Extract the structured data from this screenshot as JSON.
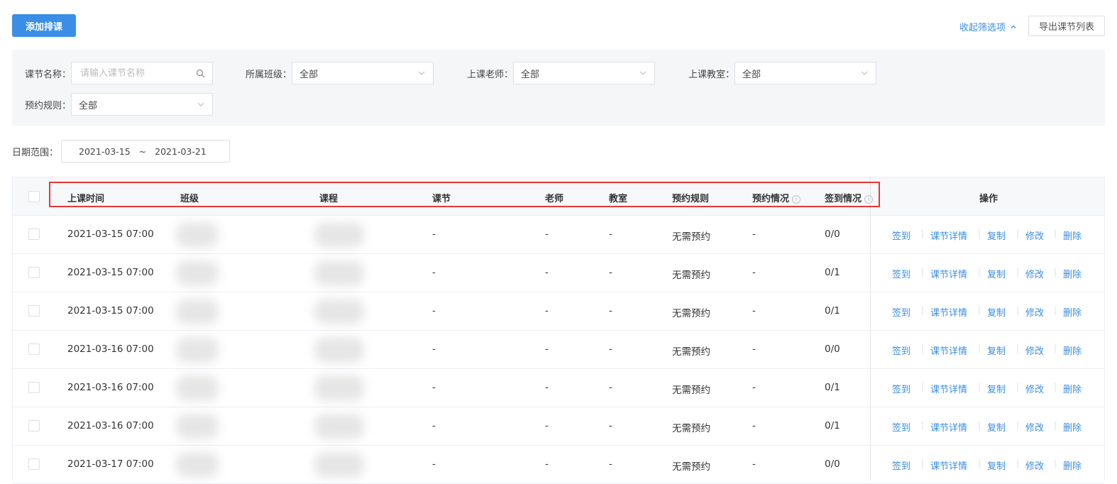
{
  "toolbar": {
    "add_label": "添加排课",
    "collapse_label": "收起筛选项",
    "export_label": "导出课节列表"
  },
  "filters": {
    "lesson_name": {
      "label": "课节名称：",
      "placeholder": "请输入课节名称"
    },
    "class": {
      "label": "所属班级：",
      "value": "全部"
    },
    "teacher": {
      "label": "上课老师：",
      "value": "全部"
    },
    "classroom": {
      "label": "上课教室：",
      "value": "全部"
    },
    "booking_rule": {
      "label": "预约规则：",
      "value": "全部"
    }
  },
  "date_range": {
    "label": "日期范围：",
    "start": "2021-03-15",
    "separator": "~",
    "end": "2021-03-21"
  },
  "table": {
    "headers": {
      "time": "上课时间",
      "class": "班级",
      "course": "课程",
      "lesson": "课节",
      "teacher": "老师",
      "classroom": "教室",
      "booking_rule": "预约规则",
      "booking_status": "预约情况",
      "signin_status": "签到情况",
      "ops": "操作"
    },
    "rows": [
      {
        "time": "2021-03-15 07:00",
        "lesson": "-",
        "teacher": "-",
        "classroom": "-",
        "booking_rule": "无需预约",
        "booking_status": "-",
        "signin": "0/0"
      },
      {
        "time": "2021-03-15 07:00",
        "lesson": "-",
        "teacher": "-",
        "classroom": "-",
        "booking_rule": "无需预约",
        "booking_status": "-",
        "signin": "0/1"
      },
      {
        "time": "2021-03-15 07:00",
        "lesson": "-",
        "teacher": "-",
        "classroom": "-",
        "booking_rule": "无需预约",
        "booking_status": "-",
        "signin": "0/1"
      },
      {
        "time": "2021-03-16 07:00",
        "lesson": "-",
        "teacher": "-",
        "classroom": "-",
        "booking_rule": "无需预约",
        "booking_status": "-",
        "signin": "0/0"
      },
      {
        "time": "2021-03-16 07:00",
        "lesson": "-",
        "teacher": "-",
        "classroom": "-",
        "booking_rule": "无需预约",
        "booking_status": "-",
        "signin": "0/1"
      },
      {
        "time": "2021-03-16 07:00",
        "lesson": "-",
        "teacher": "-",
        "classroom": "-",
        "booking_rule": "无需预约",
        "booking_status": "-",
        "signin": "0/1"
      },
      {
        "time": "2021-03-17 07:00",
        "lesson": "-",
        "teacher": "-",
        "classroom": "-",
        "booking_rule": "无需预约",
        "booking_status": "-",
        "signin": "0/0"
      }
    ],
    "actions": [
      "签到",
      "课节详情",
      "复制",
      "修改",
      "删除"
    ]
  },
  "colors": {
    "primary": "#3a8ee6",
    "highlight": "#e53935"
  },
  "icons": [
    "search-icon",
    "chevron-down-icon",
    "chevron-up-icon",
    "info-icon"
  ]
}
